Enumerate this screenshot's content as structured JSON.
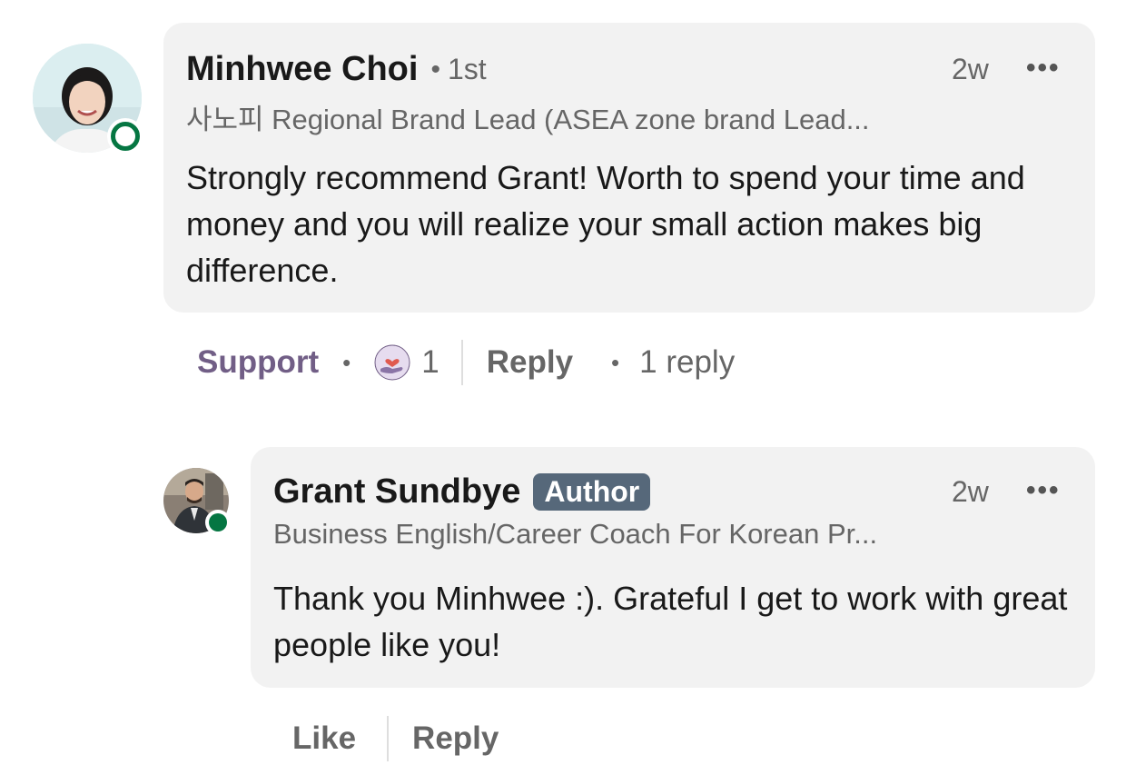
{
  "comment": {
    "author_name": "Minhwee Choi",
    "degree": "1st",
    "headline": "사노피 Regional Brand Lead (ASEA zone brand Lead...",
    "time": "2w",
    "more_label": "•••",
    "text": "Strongly recommend Grant! Worth to spend your time and money and you will realize your small action makes big difference.",
    "actions": {
      "reaction_label": "Support",
      "reaction_icon": "support-heart-hand-icon",
      "reaction_count": "1",
      "reply_label": "Reply",
      "reply_count": "1 reply"
    }
  },
  "reply": {
    "author_name": "Grant Sundbye",
    "badge": "Author",
    "headline": "Business English/Career Coach For Korean Pr...",
    "time": "2w",
    "more_label": "•••",
    "text": "Thank you Minhwee :). Grateful I get to work with great people like you!",
    "actions": {
      "like_label": "Like",
      "reply_label": "Reply"
    }
  },
  "colors": {
    "bubble_bg": "#f2f2f2",
    "presence_green": "#057642",
    "support_purple": "#715e86",
    "badge_bg": "#56687a"
  }
}
